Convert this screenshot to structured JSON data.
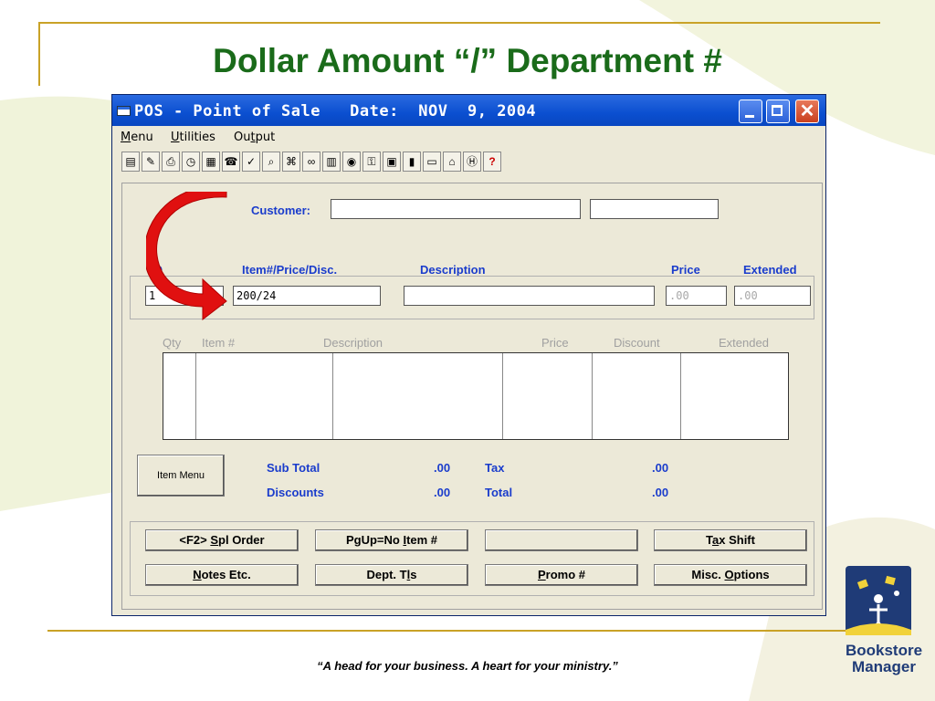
{
  "slide": {
    "title": "Dollar Amount “/” Department #",
    "tagline": "“A head for your business. A heart for your ministry.”",
    "logo_line1": "Bookstore",
    "logo_line2": "Manager"
  },
  "window": {
    "title": "POS - Point of Sale   Date:  NOV  9, 2004",
    "close_glyph": "✕"
  },
  "menu": {
    "items": [
      {
        "pre": "",
        "u": "M",
        "post": "enu"
      },
      {
        "pre": "",
        "u": "U",
        "post": "tilities"
      },
      {
        "pre": "Ou",
        "u": "t",
        "post": "put"
      }
    ]
  },
  "toolbar": {
    "help_glyph": "?"
  },
  "form": {
    "customer_label": "Customer:",
    "customer_value": "",
    "customer_value2": "",
    "qty_label": "Q",
    "item_label": "Item#/Price/Disc.",
    "description_label": "Description",
    "price_label": "Price",
    "extended_label": "Extended",
    "qty_value": "1",
    "item_value": "200/24",
    "description_value": "",
    "price_value": ".00",
    "extended_value": ".00"
  },
  "grid": {
    "headers": [
      "Qty",
      "Item #",
      "Description",
      "Price",
      "Discount",
      "Extended"
    ]
  },
  "totals": {
    "item_menu_label": "Item Menu",
    "subtotal_label": "Sub Total",
    "subtotal_value": ".00",
    "discounts_label": "Discounts",
    "discounts_value": ".00",
    "tax_label": "Tax",
    "tax_value": ".00",
    "total_label": "Total",
    "total_value": ".00"
  },
  "buttons": {
    "spl_order": {
      "pre": "<F2> ",
      "u": "S",
      "post": "pl Order"
    },
    "pgup": {
      "pre": "PgUp=No ",
      "u": "I",
      "post": "tem #"
    },
    "blank": "",
    "tax_shift": {
      "pre": "T",
      "u": "a",
      "post": "x Shift"
    },
    "notes": {
      "pre": "",
      "u": "N",
      "post": "otes Etc."
    },
    "dept": {
      "pre": "Dept. T",
      "u": "l",
      "post": "s"
    },
    "promo": {
      "pre": "",
      "u": "P",
      "post": "romo #"
    },
    "misc": {
      "pre": "Misc. ",
      "u": "O",
      "post": "ptions"
    }
  }
}
